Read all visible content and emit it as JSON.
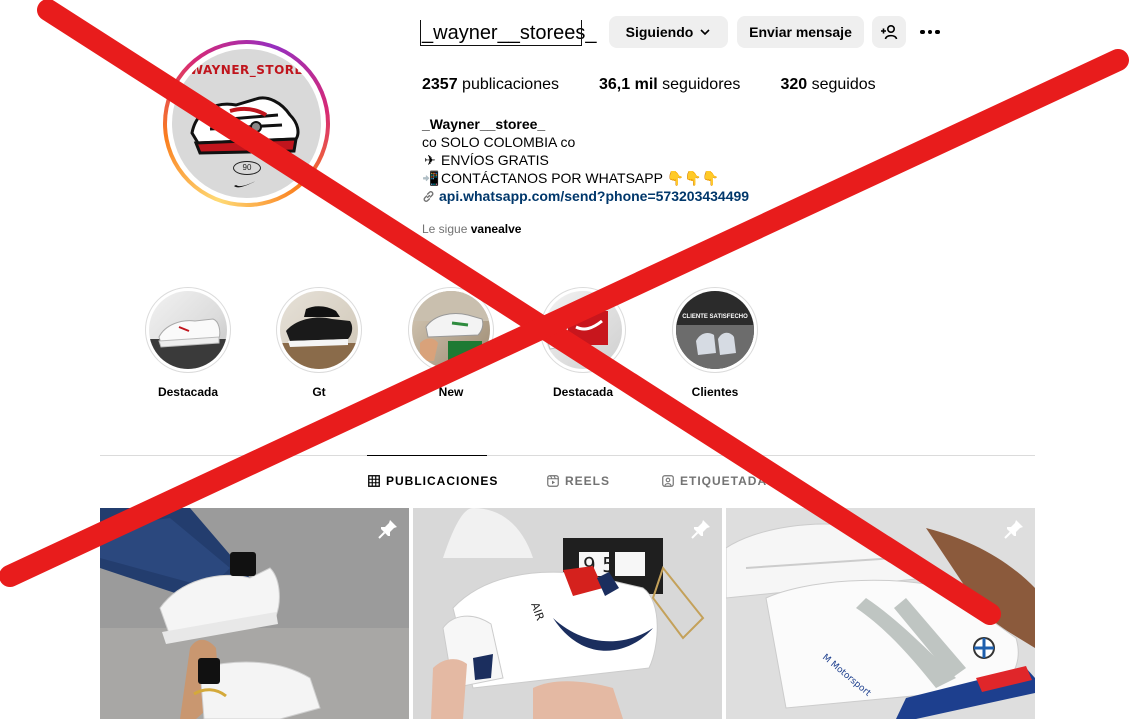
{
  "profile": {
    "username": "_wayner__storees_",
    "avatar_text": "WAYNER_STORE",
    "avatar_number": "90"
  },
  "actions": {
    "following_label": "Siguiendo",
    "message_label": "Enviar mensaje"
  },
  "stats": {
    "posts_value": "2357",
    "posts_label": "publicaciones",
    "followers_value": "36,1 mil",
    "followers_label": "seguidores",
    "following_value": "320",
    "following_label": "seguidos"
  },
  "bio": {
    "name": "_Wayner__storee_",
    "line1": "co SOLO COLOMBIA co",
    "line2": "ENVÍOS GRATIS",
    "line3": "CONTÁCTANOS POR WHATSAPP 👇👇👇",
    "link": "api.whatsapp.com/send?phone=573203434499",
    "followed_by_prefix": "Le sigue",
    "followed_by_user": "vanealve"
  },
  "highlights": [
    {
      "label": "Destacada"
    },
    {
      "label": "Gt"
    },
    {
      "label": "New"
    },
    {
      "label": "Destacada"
    },
    {
      "label": "Clientes",
      "overlay_text": "CLIENTE SATISFECHO"
    }
  ],
  "tabs": {
    "posts": "PUBLICACIONES",
    "reels": "REELS",
    "tagged": "ETIQUETADAS"
  },
  "posts": [
    {
      "pinned": true
    },
    {
      "pinned": true,
      "box_text": "9 5",
      "shoe_text": "AIR"
    },
    {
      "pinned": true,
      "shoe_text": "M Motorsport"
    }
  ],
  "colors": {
    "overlay_x": "#e81c1c",
    "link": "#00376b",
    "muted": "#737373",
    "button_bg": "#efefef"
  }
}
